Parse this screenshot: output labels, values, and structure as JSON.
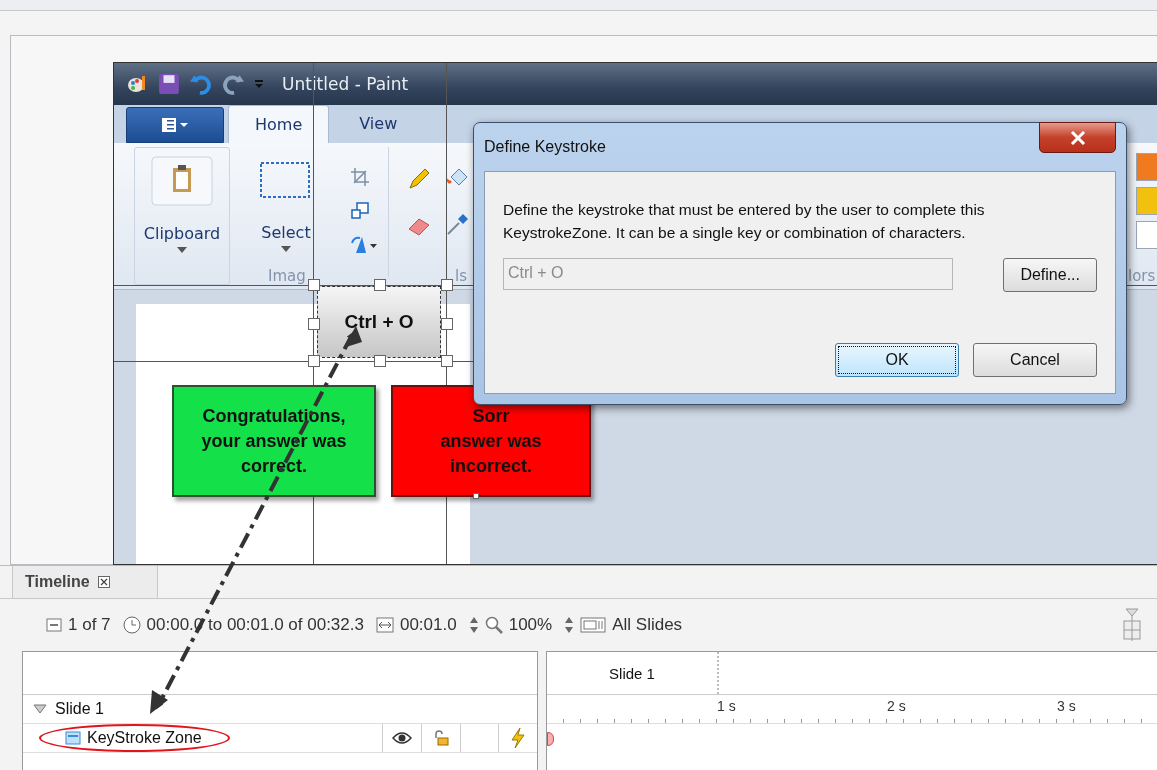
{
  "paint": {
    "title": "Untitled - Paint",
    "tabs": [
      {
        "label": "Home",
        "selected": true
      },
      {
        "label": "View",
        "selected": false
      }
    ],
    "groups": [
      {
        "label": "Clipboard"
      },
      {
        "label": "Select"
      }
    ],
    "captions": [
      "Imag",
      "ls",
      "lors"
    ],
    "palette": [
      {
        "color": "#f07a20"
      },
      {
        "color": "#f2c00e"
      },
      {
        "color": "#ffffff"
      }
    ]
  },
  "slide": {
    "keystroke_zone": "Ctrl + O",
    "feedback": [
      {
        "kind": "correct",
        "lines": [
          "Congratulations,",
          "your answer was",
          "correct."
        ]
      },
      {
        "kind": "incorrect",
        "lines": [
          "Sorr",
          "answer was",
          "incorrect."
        ]
      }
    ]
  },
  "dialog": {
    "title": "Define Keystroke",
    "message": "Define the keystroke that must be entered by the user to complete this KeystrokeZone. It can be a single key or combination of characters.",
    "field": {
      "value": "Ctrl + O",
      "disabled": true
    },
    "define_button": "Define...",
    "actions": [
      {
        "label": "OK",
        "focused": true
      },
      {
        "label": "Cancel",
        "focused": false
      }
    ]
  },
  "timeline": {
    "title": "Timeline",
    "slide_count": "1 of 7",
    "range": "00:00.0 to 00:01.0 of 00:32.3",
    "duration": "00:01.0",
    "zoom": "100%",
    "scope": "All Slides",
    "header": "Slide 1",
    "ruler": [
      "1 s",
      "2 s",
      "3 s"
    ],
    "tree": [
      {
        "label": "Slide 1",
        "expanded": true,
        "children": [
          {
            "label": "KeyStroke Zone",
            "highlighted": true
          }
        ]
      }
    ]
  }
}
